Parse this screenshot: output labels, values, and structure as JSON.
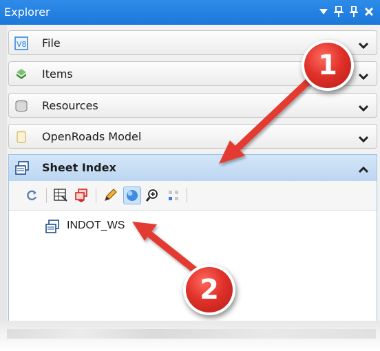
{
  "window": {
    "title": "Explorer"
  },
  "sections": [
    {
      "label": "File",
      "icon": "v8-icon"
    },
    {
      "label": "Items",
      "icon": "items-icon"
    },
    {
      "label": "Resources",
      "icon": "database-icon"
    },
    {
      "label": "OpenRoads Model",
      "icon": "model-icon"
    }
  ],
  "sheet_index": {
    "label": "Sheet Index",
    "toolbar": [
      "refresh-icon",
      "grid-properties-icon",
      "sheets-red-icon",
      "pencil-icon",
      "sphere-icon",
      "zoom-icon",
      "dots-grid-icon"
    ],
    "tree": [
      {
        "label": "INDOT_WS"
      }
    ]
  },
  "callouts": [
    {
      "number": "1"
    },
    {
      "number": "2"
    }
  ],
  "colors": {
    "title_bar": "#1c78da",
    "accent_header": "#bcd6f2",
    "callout_red": "#e0322a"
  }
}
